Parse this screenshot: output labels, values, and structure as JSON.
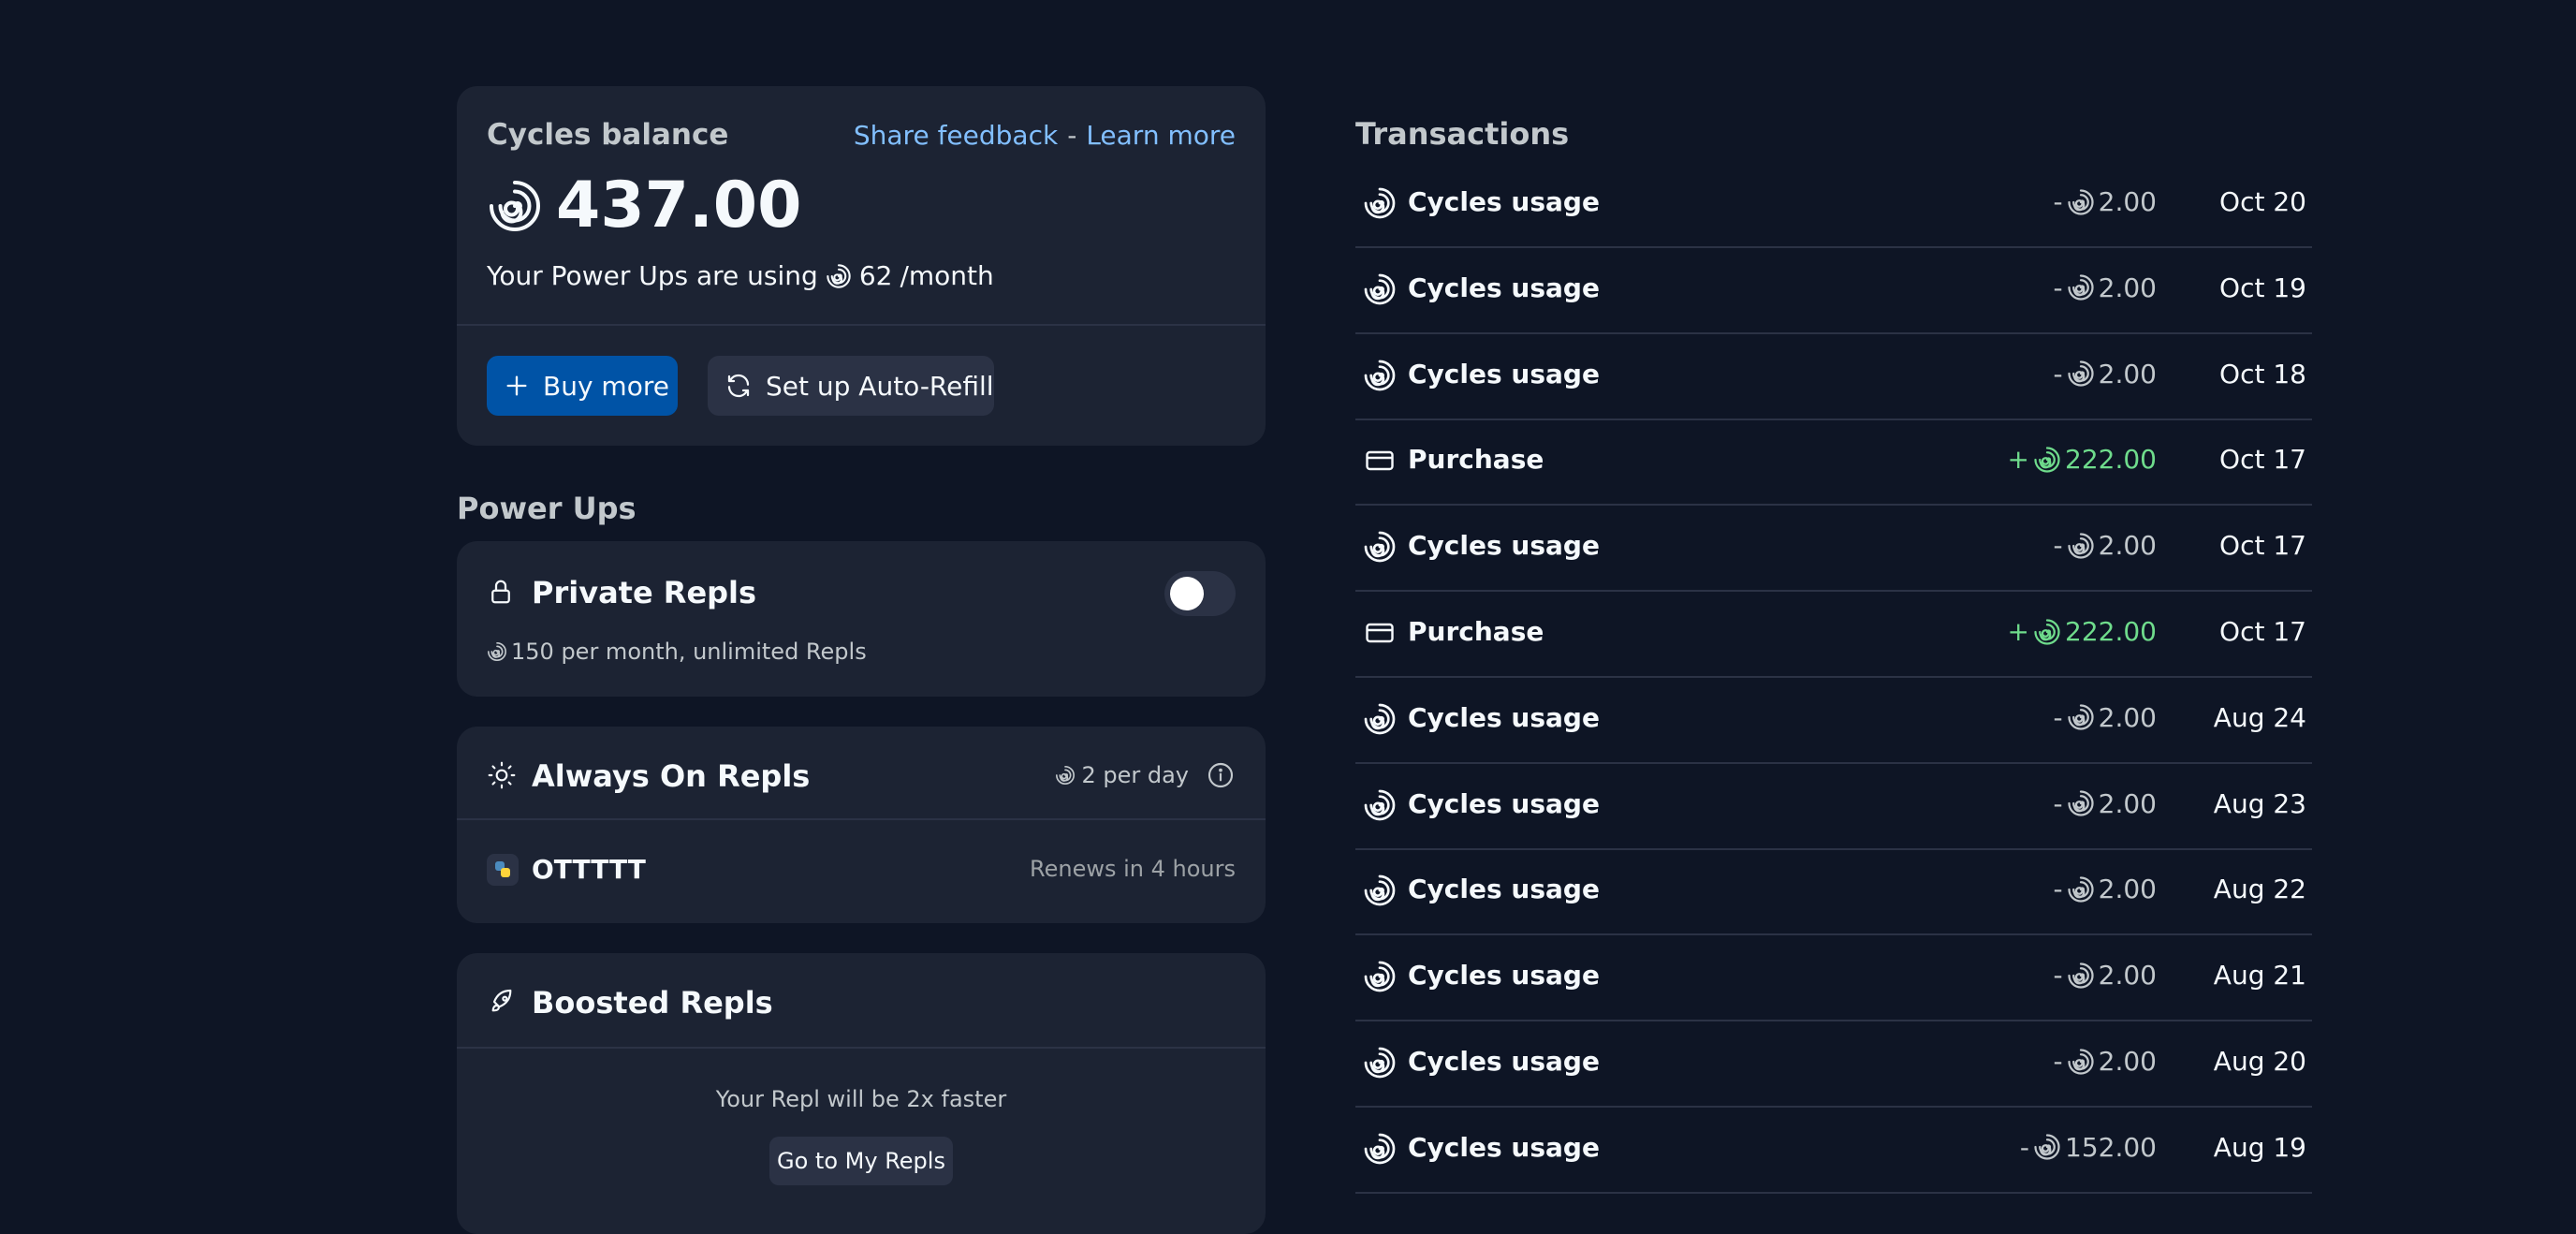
{
  "balance": {
    "title": "Cycles balance",
    "share_feedback": "Share feedback",
    "separator": "-",
    "learn_more": "Learn more",
    "amount": "437.00",
    "usage_prefix": "Your Power Ups are using",
    "usage_amount": "62",
    "usage_suffix": "/month",
    "buy_more": "Buy more",
    "auto_refill": "Set up Auto-Refill"
  },
  "power_ups": {
    "title": "Power Ups",
    "private": {
      "title": "Private Repls",
      "desc": "150 per month, unlimited Repls",
      "toggle_on": false
    },
    "always_on": {
      "title": "Always On Repls",
      "cost": "2 per day",
      "repl_name": "OTTTTT",
      "renews": "Renews in 4 hours"
    },
    "boosted": {
      "title": "Boosted Repls",
      "desc": "Your Repl will be 2x faster",
      "button": "Go to My Repls"
    }
  },
  "transactions": {
    "title": "Transactions",
    "rows": [
      {
        "type": "cycles",
        "label": "Cycles usage",
        "sign": "-",
        "amount": "2.00",
        "date": "Oct 20"
      },
      {
        "type": "cycles",
        "label": "Cycles usage",
        "sign": "-",
        "amount": "2.00",
        "date": "Oct 19"
      },
      {
        "type": "cycles",
        "label": "Cycles usage",
        "sign": "-",
        "amount": "2.00",
        "date": "Oct 18"
      },
      {
        "type": "purchase",
        "label": "Purchase",
        "sign": "+",
        "amount": "222.00",
        "date": "Oct 17"
      },
      {
        "type": "cycles",
        "label": "Cycles usage",
        "sign": "-",
        "amount": "2.00",
        "date": "Oct 17"
      },
      {
        "type": "purchase",
        "label": "Purchase",
        "sign": "+",
        "amount": "222.00",
        "date": "Oct 17"
      },
      {
        "type": "cycles",
        "label": "Cycles usage",
        "sign": "-",
        "amount": "2.00",
        "date": "Aug 24"
      },
      {
        "type": "cycles",
        "label": "Cycles usage",
        "sign": "-",
        "amount": "2.00",
        "date": "Aug 23"
      },
      {
        "type": "cycles",
        "label": "Cycles usage",
        "sign": "-",
        "amount": "2.00",
        "date": "Aug 22"
      },
      {
        "type": "cycles",
        "label": "Cycles usage",
        "sign": "-",
        "amount": "2.00",
        "date": "Aug 21"
      },
      {
        "type": "cycles",
        "label": "Cycles usage",
        "sign": "-",
        "amount": "2.00",
        "date": "Aug 20"
      },
      {
        "type": "cycles",
        "label": "Cycles usage",
        "sign": "-",
        "amount": "152.00",
        "date": "Aug 19"
      }
    ]
  },
  "colors": {
    "background": "#0e1525",
    "card": "#1c2333",
    "primary_button": "#0053a6",
    "link": "#82bfff",
    "positive": "#6fdc8c"
  }
}
